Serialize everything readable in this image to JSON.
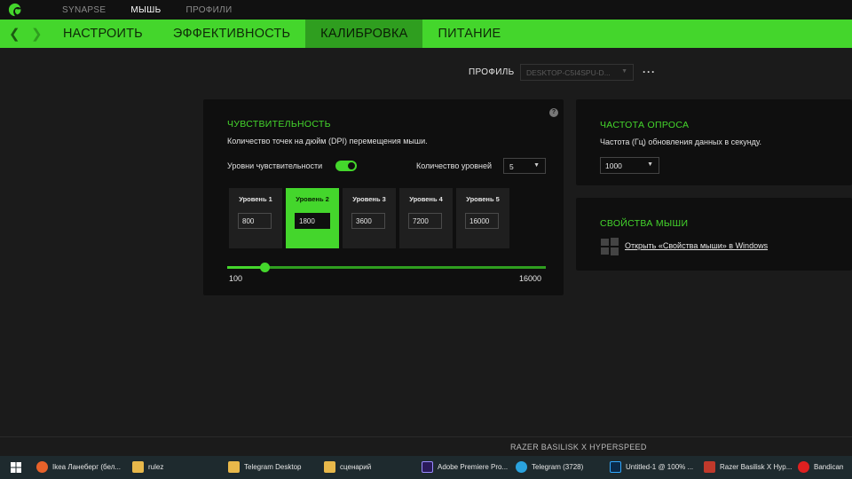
{
  "topnav": {
    "items": [
      "SYNAPSE",
      "МЫШЬ",
      "ПРОФИЛИ"
    ],
    "active": 1
  },
  "tabs": [
    "НАСТРОИТЬ",
    "ЭФФЕКТИВНОСТЬ",
    "КАЛИБРОВКА",
    "ПИТАНИЕ"
  ],
  "active_tab": 2,
  "profile": {
    "label": "ПРОФИЛЬ",
    "value": "DESKTOP-C5I4SPU-D..."
  },
  "sensitivity": {
    "title": "ЧУВСТВИТЕЛЬНОСТЬ",
    "description": "Количество точек на дюйм (DPI) перемещения мыши.",
    "levels_label": "Уровни чувствительности",
    "levels_enabled": true,
    "count_label": "Количество уровней",
    "count_value": "5",
    "levels": [
      {
        "name": "Уровень 1",
        "value": "800"
      },
      {
        "name": "Уровень 2",
        "value": "1800"
      },
      {
        "name": "Уровень 3",
        "value": "3600"
      },
      {
        "name": "Уровень 4",
        "value": "7200"
      },
      {
        "name": "Уровень 5",
        "value": "16000"
      }
    ],
    "active_level": 1,
    "slider": {
      "min": "100",
      "max": "16000",
      "value": 1800
    }
  },
  "polling": {
    "title": "ЧАСТОТА ОПРОСА",
    "description": "Частота (Гц) обновления данных в секунду.",
    "value": "1000"
  },
  "mouse_props": {
    "title": "СВОЙСТВА МЫШИ",
    "link": "Открыть «Свойства мыши» в Windows"
  },
  "device_name": "RAZER BASILISK X HYPERSPEED",
  "taskbar": [
    {
      "label": "Ikea Ланеберг (бел...",
      "icon": "firefox-icon",
      "color": "#e8622a"
    },
    {
      "label": "rulez",
      "icon": "folder-icon",
      "color": "#e8b84a"
    },
    {
      "label": "Telegram Desktop",
      "icon": "folder-icon",
      "color": "#e8b84a"
    },
    {
      "label": "сценарий",
      "icon": "folder-icon",
      "color": "#e8b84a"
    },
    {
      "label": "Adobe Premiere Pro...",
      "icon": "premiere-icon",
      "color": "#2a1a5a"
    },
    {
      "label": "Telegram (3728)",
      "icon": "telegram-icon",
      "color": "#2aa3de"
    },
    {
      "label": "Untitled-1 @ 100% ...",
      "icon": "photoshop-icon",
      "color": "#0a2a4a"
    },
    {
      "label": "Razer Basilisk X Hyp...",
      "icon": "razer-icon",
      "color": "#c0392b"
    },
    {
      "label": "Bandicam",
      "icon": "bandicam-icon",
      "color": "#e02020"
    }
  ],
  "colors": {
    "accent": "#44d62c",
    "accent_dark": "#2f9e1f",
    "background": "#1b1b1b",
    "panel": "#0f0f0f"
  }
}
